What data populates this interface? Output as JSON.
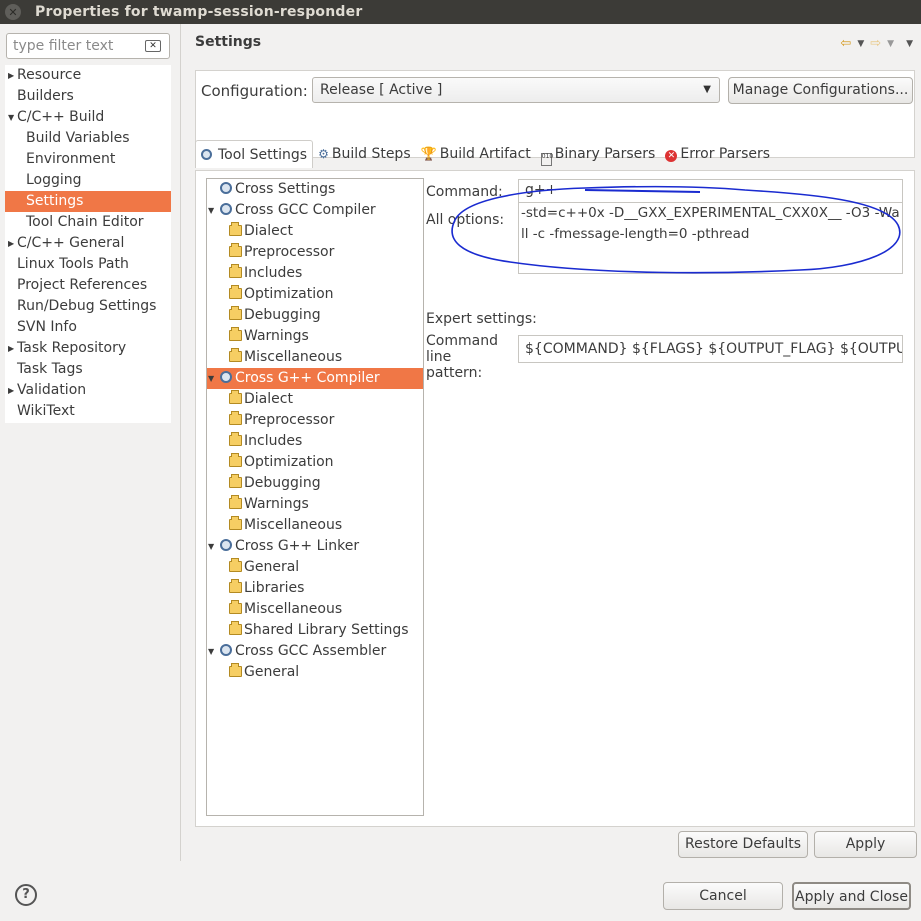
{
  "window": {
    "title": "Properties for twamp-session-responder",
    "close_glyph": "✕"
  },
  "filter": {
    "placeholder": "type filter text"
  },
  "nav": {
    "items": [
      {
        "label": "Resource",
        "expandable": true,
        "level": 0
      },
      {
        "label": "Builders",
        "expandable": false,
        "level": 0
      },
      {
        "label": "C/C++ Build",
        "expandable": true,
        "expanded": true,
        "level": 0
      },
      {
        "label": "Build Variables",
        "level": 1
      },
      {
        "label": "Environment",
        "level": 1
      },
      {
        "label": "Logging",
        "level": 1
      },
      {
        "label": "Settings",
        "level": 1,
        "selected": true
      },
      {
        "label": "Tool Chain Editor",
        "level": 1
      },
      {
        "label": "C/C++ General",
        "expandable": true,
        "level": 0
      },
      {
        "label": "Linux Tools Path",
        "level": 0
      },
      {
        "label": "Project References",
        "level": 0
      },
      {
        "label": "Run/Debug Settings",
        "level": 0
      },
      {
        "label": "SVN Info",
        "level": 0
      },
      {
        "label": "Task Repository",
        "expandable": true,
        "level": 0
      },
      {
        "label": "Task Tags",
        "level": 0
      },
      {
        "label": "Validation",
        "expandable": true,
        "level": 0
      },
      {
        "label": "WikiText",
        "level": 0
      }
    ]
  },
  "page": {
    "title": "Settings"
  },
  "config": {
    "label": "Configuration:",
    "value": "Release  [ Active ]",
    "manage_button": "Manage Configurations..."
  },
  "tabs": [
    {
      "label": "Tool Settings",
      "icon": "gear-icon",
      "active": true
    },
    {
      "label": "Build Steps",
      "icon": "build-steps-icon"
    },
    {
      "label": "Build Artifact",
      "icon": "trophy-icon"
    },
    {
      "label": "Binary Parsers",
      "icon": "binary-icon"
    },
    {
      "label": "Error Parsers",
      "icon": "error-icon"
    }
  ],
  "tooltree": {
    "items": [
      {
        "label": "Cross Settings",
        "level": 0,
        "icon": "gear-icon"
      },
      {
        "label": "Cross GCC Compiler",
        "level": 0,
        "icon": "gear-icon",
        "expanded": true
      },
      {
        "label": "Dialect",
        "level": 1,
        "icon": "folder-icon"
      },
      {
        "label": "Preprocessor",
        "level": 1,
        "icon": "folder-icon"
      },
      {
        "label": "Includes",
        "level": 1,
        "icon": "folder-icon"
      },
      {
        "label": "Optimization",
        "level": 1,
        "icon": "folder-icon"
      },
      {
        "label": "Debugging",
        "level": 1,
        "icon": "folder-icon"
      },
      {
        "label": "Warnings",
        "level": 1,
        "icon": "folder-icon"
      },
      {
        "label": "Miscellaneous",
        "level": 1,
        "icon": "folder-icon"
      },
      {
        "label": "Cross G++ Compiler",
        "level": 0,
        "icon": "gear-icon",
        "expanded": true,
        "selected": true
      },
      {
        "label": "Dialect",
        "level": 1,
        "icon": "folder-icon"
      },
      {
        "label": "Preprocessor",
        "level": 1,
        "icon": "folder-icon"
      },
      {
        "label": "Includes",
        "level": 1,
        "icon": "folder-icon"
      },
      {
        "label": "Optimization",
        "level": 1,
        "icon": "folder-icon"
      },
      {
        "label": "Debugging",
        "level": 1,
        "icon": "folder-icon"
      },
      {
        "label": "Warnings",
        "level": 1,
        "icon": "folder-icon"
      },
      {
        "label": "Miscellaneous",
        "level": 1,
        "icon": "folder-icon"
      },
      {
        "label": "Cross G++ Linker",
        "level": 0,
        "icon": "gear-icon",
        "expanded": true
      },
      {
        "label": "General",
        "level": 1,
        "icon": "folder-icon"
      },
      {
        "label": "Libraries",
        "level": 1,
        "icon": "folder-icon"
      },
      {
        "label": "Miscellaneous",
        "level": 1,
        "icon": "folder-icon"
      },
      {
        "label": "Shared Library Settings",
        "level": 1,
        "icon": "folder-icon"
      },
      {
        "label": "Cross GCC Assembler",
        "level": 0,
        "icon": "gear-icon",
        "expanded": true
      },
      {
        "label": "General",
        "level": 1,
        "icon": "folder-icon"
      }
    ]
  },
  "command": {
    "label": "Command:",
    "value": "g++"
  },
  "all_options": {
    "label": "All options:",
    "value": "-std=c++0x -D__GXX_EXPERIMENTAL_CXX0X__ -O3 -Wall -c -fmessage-length=0 -pthread"
  },
  "expert": {
    "heading": "Expert settings:",
    "label": "Command line pattern:",
    "value": "${COMMAND} ${FLAGS} ${OUTPUT_FLAG} ${OUTPUT_PREFIX}${OUTPUT} ${INPUTS}"
  },
  "buttons": {
    "restore_defaults": "Restore Defaults",
    "apply": "Apply",
    "cancel": "Cancel",
    "apply_close": "Apply and Close"
  },
  "help": {
    "glyph": "?"
  },
  "colors": {
    "selection": "#f07746",
    "titlebar": "#3c3b37",
    "annotation": "#1a2bd0"
  }
}
